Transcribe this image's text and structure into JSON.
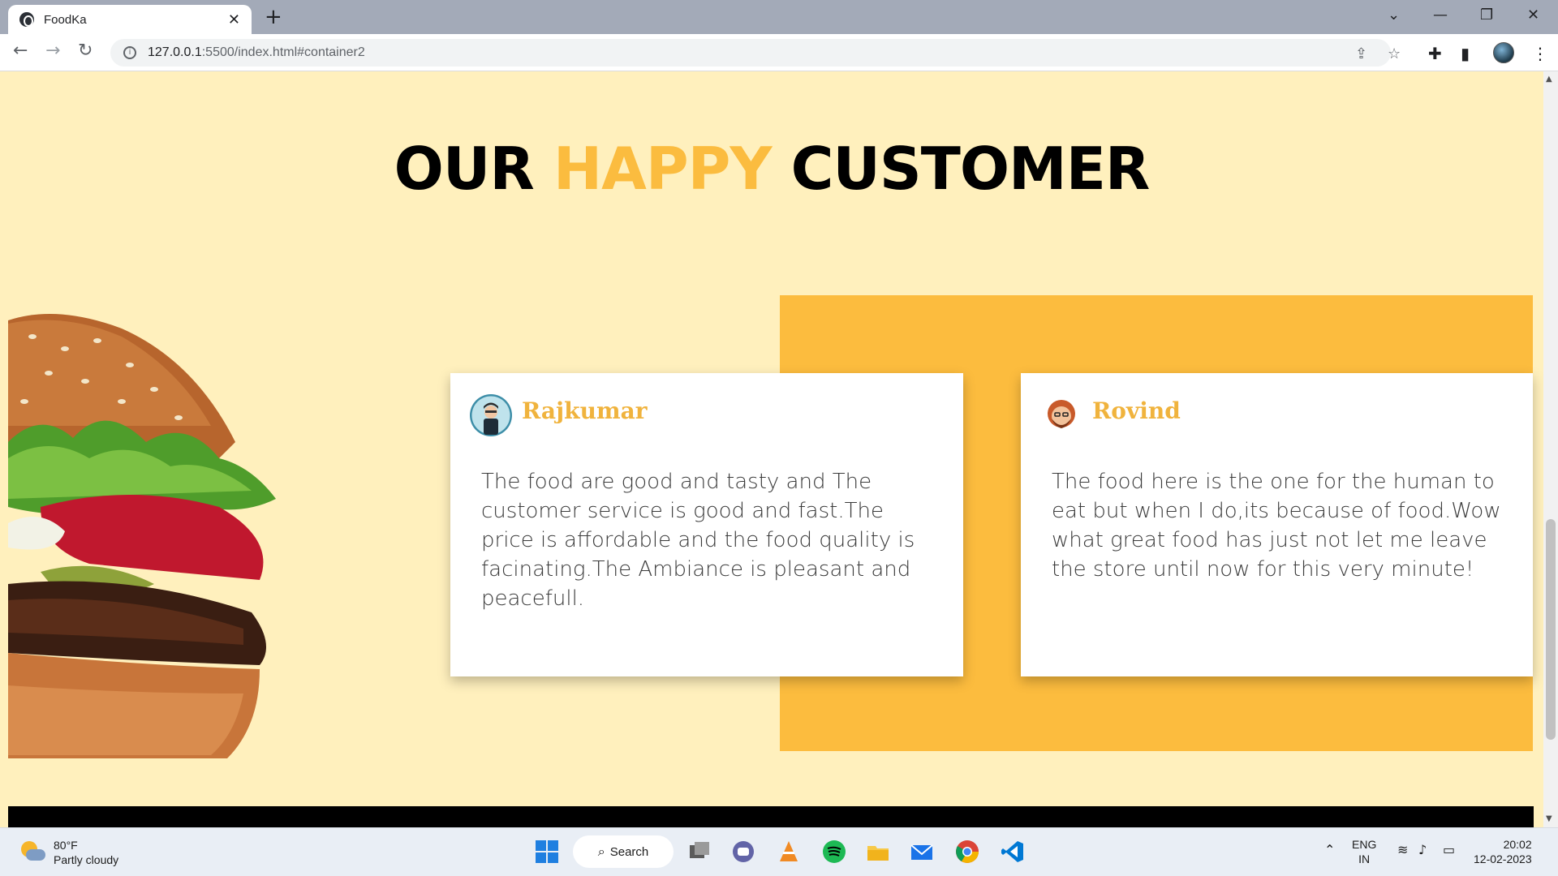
{
  "browser": {
    "tab_title": "FoodKa",
    "tab_close": "✕",
    "new_tab": "+",
    "url_host": "127.0.0.1",
    "url_rest": ":5500/index.html#container2",
    "window_controls": [
      "⌄",
      "—",
      "❐",
      "✕"
    ]
  },
  "page": {
    "heading_part1": "OUR",
    "heading_highlight": "HAPPY",
    "heading_part2": "CUSTOMER",
    "colors": {
      "background": "#fff0bd",
      "accent": "#fcbc3e",
      "name_color": "#f0b33d"
    },
    "testimonials": [
      {
        "name": "Rajkumar",
        "review": "The food are good and tasty and The customer service is good and fast.The price is affordable and the food quality is facinating.The Ambiance is pleasant and peacefull."
      },
      {
        "name": "Rovind",
        "review": "The food here is the one for the human to eat but when I do,its because of food.Wow what great food has just not let me leave the store until now for this very minute!"
      }
    ]
  },
  "taskbar": {
    "weather_temp": "80°F",
    "weather_desc": "Partly cloudy",
    "search_label": "Search",
    "language_top": "ENG",
    "language_bottom": "IN",
    "time": "20:02",
    "date": "12-02-2023"
  }
}
